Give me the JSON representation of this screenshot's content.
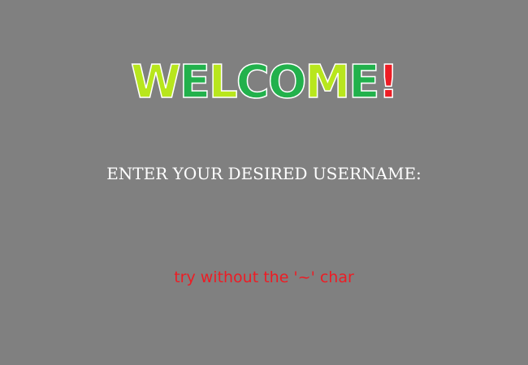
{
  "welcome": {
    "letters": [
      {
        "char": "W",
        "color": "#b8e61d"
      },
      {
        "char": "E",
        "color": "#22b14c"
      },
      {
        "char": "L",
        "color": "#b8e61d"
      },
      {
        "char": "C",
        "color": "#22b14c"
      },
      {
        "char": "O",
        "color": "#22b14c"
      },
      {
        "char": "M",
        "color": "#b8e61d"
      },
      {
        "char": "E",
        "color": "#22b14c"
      },
      {
        "char": "!",
        "color": "#ed1c24"
      }
    ]
  },
  "prompt": {
    "text": "ENTER YOUR DESIRED USERNAME:"
  },
  "username_input": {
    "value": "",
    "placeholder": ""
  },
  "hint": {
    "text": "try without the '~' char",
    "color": "#ed1c24"
  },
  "colors": {
    "background": "#808080",
    "prompt_text": "#ffffff"
  }
}
